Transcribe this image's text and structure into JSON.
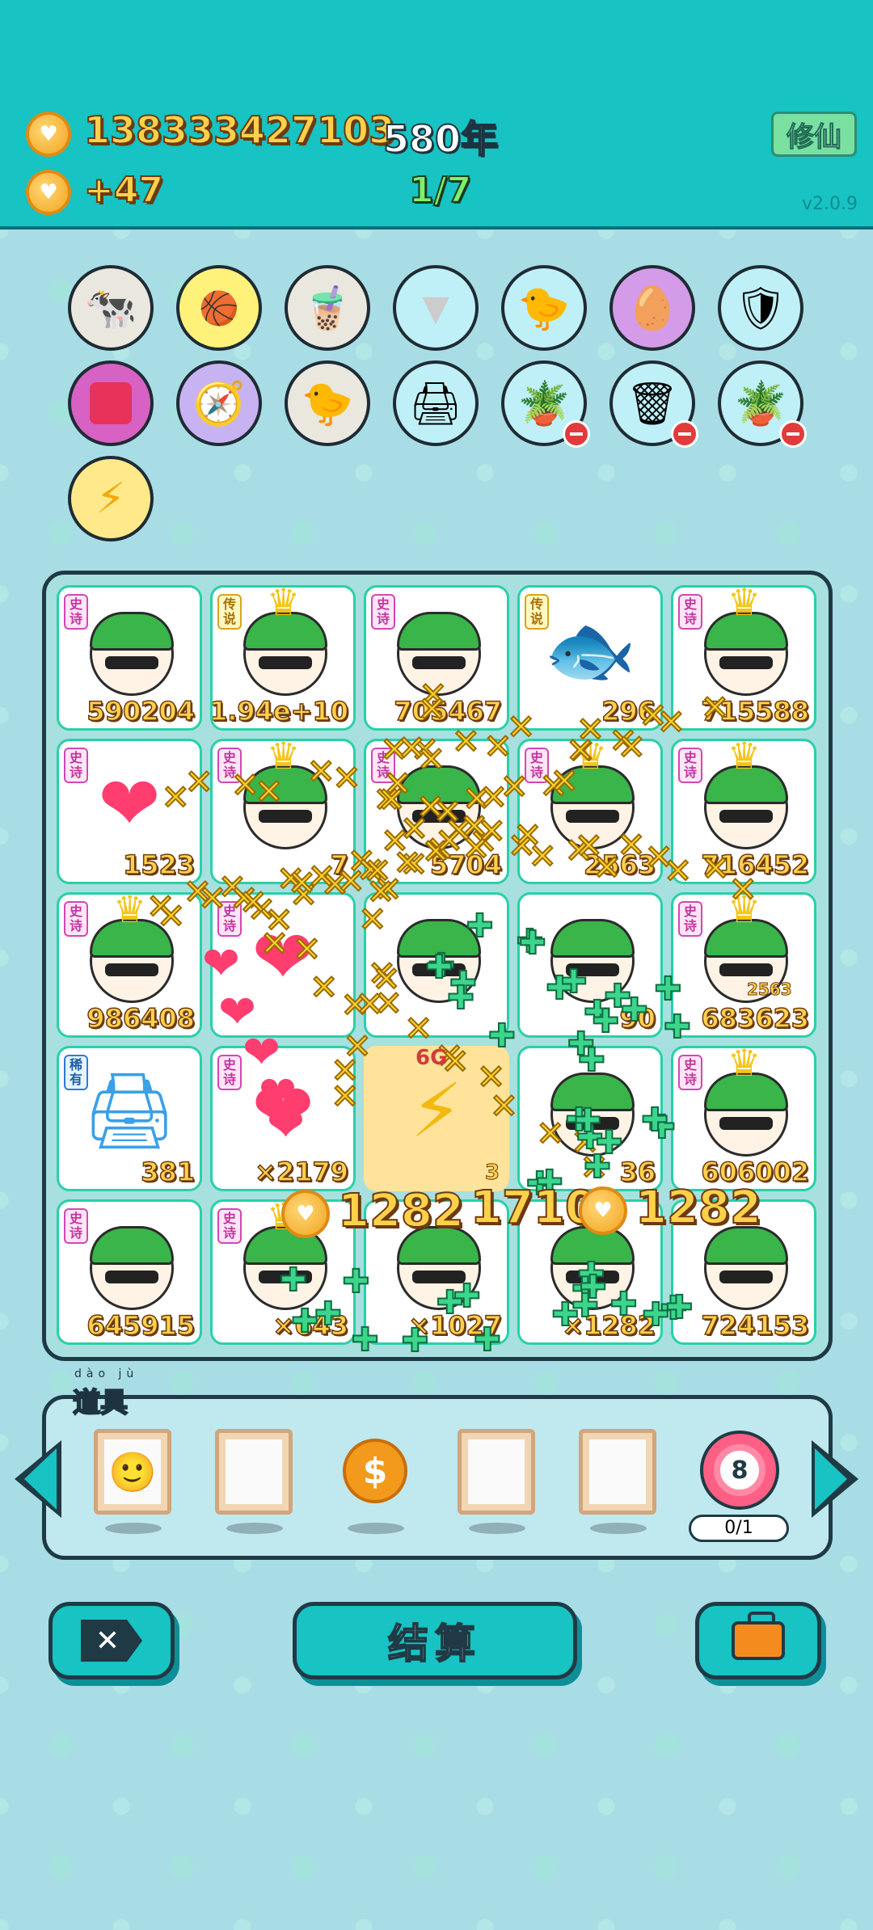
{
  "header": {
    "coins": "138333427103",
    "coin_rate": "+47",
    "years": "580年",
    "round": "1/7",
    "cultivate_button": "修仙",
    "version": "v2.0.9"
  },
  "relics": [
    {
      "icon": "cow-icon"
    },
    {
      "icon": "basketballs-icon"
    },
    {
      "icon": "bubble-tea-icon"
    },
    {
      "icon": "skirt-icon"
    },
    {
      "icon": "chick-egg-icon"
    },
    {
      "icon": "egg-in-shell-icon"
    },
    {
      "icon": "shield-wrench-icon"
    },
    {
      "icon": "red-bag-icon"
    },
    {
      "icon": "compass-icon"
    },
    {
      "icon": "chick-egg-icon"
    },
    {
      "icon": "printer-warning-icon"
    },
    {
      "icon": "flower-pot-icon"
    },
    {
      "icon": "trash-bag-icon"
    },
    {
      "icon": "flower-pot-icon"
    },
    {
      "icon": "lightning-icon"
    }
  ],
  "board": {
    "cells": [
      {
        "tag": "史诗",
        "kind": "epic",
        "value": "590204",
        "icon": "green-hat-sunglasses-face"
      },
      {
        "tag": "传说",
        "kind": "legend",
        "value": "1.94e+10",
        "icon": "king-glasses-face"
      },
      {
        "tag": "史诗",
        "kind": "epic",
        "value": "705467",
        "icon": "green-hat-sunglasses-face"
      },
      {
        "tag": "传说",
        "kind": "legend",
        "value": "296",
        "icon": "koi-fish"
      },
      {
        "tag": "史诗",
        "kind": "epic",
        "value": "715588",
        "icon": "king-sunglasses-face"
      },
      {
        "tag": "史诗",
        "kind": "epic",
        "value": "1523",
        "icon": "heart"
      },
      {
        "tag": "史诗",
        "kind": "epic",
        "value": "7",
        "icon": "king-sunglasses-face"
      },
      {
        "tag": "史诗",
        "kind": "epic",
        "value": "5704",
        "icon": "green-hat-sunglasses-face"
      },
      {
        "tag": "史诗",
        "kind": "epic",
        "value": "2563",
        "icon": "king-sunglasses-face"
      },
      {
        "tag": "史诗",
        "kind": "epic",
        "value": "716452",
        "icon": "king-sunglasses-face"
      },
      {
        "tag": "史诗",
        "kind": "epic",
        "value": "986408",
        "icon": "king-sunglasses-face"
      },
      {
        "tag": "史诗",
        "kind": "epic",
        "value": "",
        "icon": "heart"
      },
      {
        "tag": "",
        "kind": "epic",
        "value": "",
        "icon": "green-hat-sunglasses-face"
      },
      {
        "tag": "",
        "kind": "epic",
        "value": "90",
        "icon": "green-hat-sunglasses-face"
      },
      {
        "tag": "史诗",
        "kind": "epic",
        "value": "683623",
        "icon": "king-sunglasses-face"
      },
      {
        "tag": "稀有",
        "kind": "rare",
        "value": "381",
        "icon": "printer"
      },
      {
        "tag": "史诗",
        "kind": "epic",
        "value": "×2179",
        "icon": "heart"
      },
      {
        "tag": "",
        "kind": "empty",
        "value": "",
        "icon": "sparkle"
      },
      {
        "tag": "",
        "kind": "epic",
        "value": "36",
        "icon": "green-hat-sunglasses-face"
      },
      {
        "tag": "史诗",
        "kind": "epic",
        "value": "606002",
        "icon": "king-sunglasses-face"
      },
      {
        "tag": "史诗",
        "kind": "epic",
        "value": "645915",
        "icon": "green-hat-heart-glasses-face"
      },
      {
        "tag": "史诗",
        "kind": "epic",
        "value": "×643",
        "icon": "king-sunglasses-face"
      },
      {
        "tag": "",
        "kind": "epic",
        "value": "×1027",
        "icon": "green-hat-sunglasses-face"
      },
      {
        "tag": "",
        "kind": "epic",
        "value": "×1282",
        "icon": "green-hat-sunglasses-face"
      },
      {
        "tag": "",
        "kind": "epic",
        "value": "724153",
        "icon": "green-hat-sunglasses-face"
      }
    ],
    "floating": [
      "1282",
      "1710",
      "1282"
    ],
    "small_coin_label": "2563",
    "mini_labels": [
      "6G",
      "3"
    ]
  },
  "items": {
    "label": "道具",
    "ruby": "dào jù",
    "slots": [
      {
        "icon": "face-portrait-icon"
      },
      {
        "icon": ""
      },
      {
        "icon": "dollar-coin-icon"
      },
      {
        "icon": ""
      },
      {
        "icon": ""
      },
      {
        "icon": "target-8-icon"
      }
    ],
    "target_number": "8",
    "counter": "0/1",
    "dollar_symbol": "$"
  },
  "buttons": {
    "settle": "结算"
  },
  "colors": {
    "header_bg": "#17c3c3",
    "gold": "#ffd14a",
    "epic_tag": "#c2349f",
    "legend_tag": "#a86f00",
    "rare_tag": "#1c5aa6"
  }
}
